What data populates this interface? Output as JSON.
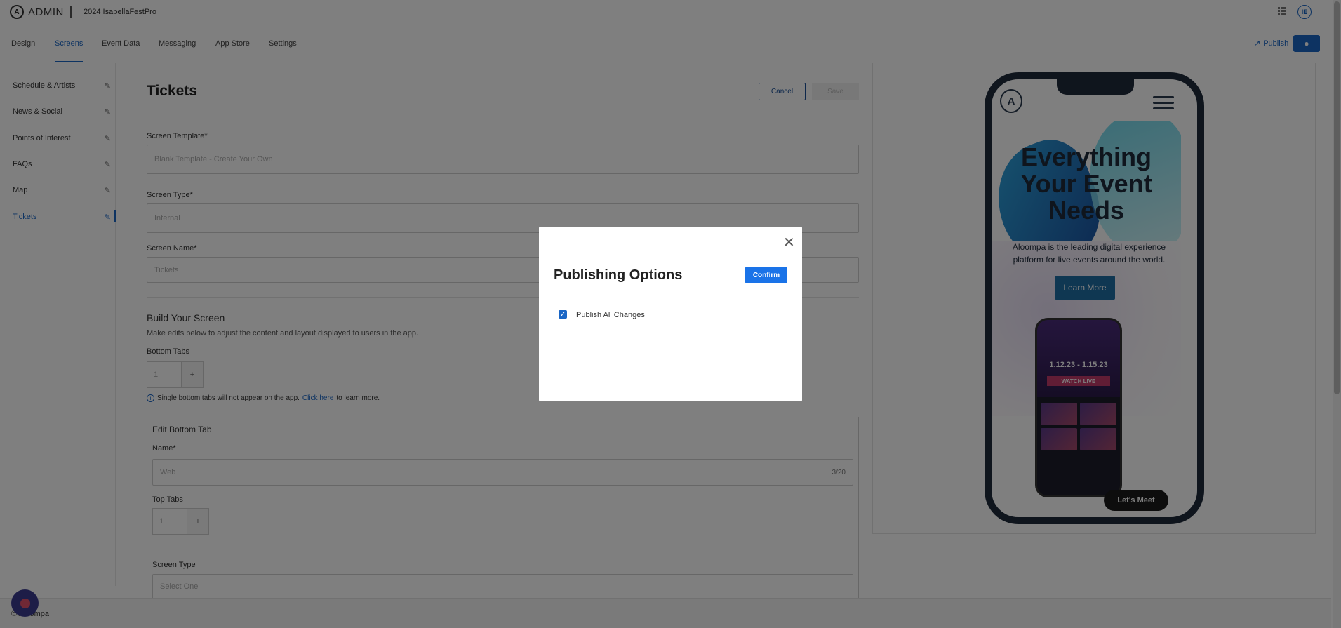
{
  "header": {
    "logo_text": "ADMIN",
    "logo_mark": "A",
    "project_name": "2024 IsabellaFestPro",
    "avatar_initials": "IE"
  },
  "nav": {
    "tabs": [
      {
        "label": "Design"
      },
      {
        "label": "Screens"
      },
      {
        "label": "Event Data"
      },
      {
        "label": "Messaging"
      },
      {
        "label": "App Store"
      },
      {
        "label": "Settings"
      }
    ],
    "active_tab": "Screens",
    "publish_label": "Publish",
    "apple_icon": "apple-icon"
  },
  "sidebar": {
    "items": [
      {
        "label": "Schedule & Artists"
      },
      {
        "label": "News & Social"
      },
      {
        "label": "Points of Interest"
      },
      {
        "label": "FAQs"
      },
      {
        "label": "Map"
      },
      {
        "label": "Tickets"
      }
    ],
    "active_item": "Tickets"
  },
  "main": {
    "title": "Tickets",
    "cancel_label": "Cancel",
    "save_label": "Save",
    "screen_template_label": "Screen Template*",
    "screen_template_value": "Blank Template - Create Your Own",
    "screen_type_label": "Screen Type*",
    "screen_type_value": "Internal",
    "screen_name_label": "Screen Name*",
    "screen_name_value": "Tickets",
    "build_title": "Build Your Screen",
    "build_desc": "Make edits below to adjust the content and layout displayed to users in the app.",
    "bottom_tabs_label": "Bottom Tabs",
    "bottom_tabs_value": "1",
    "plus": "+",
    "info_text": "Single bottom tabs will not appear on the app.",
    "info_link": "Click here",
    "info_suffix": "to learn more.",
    "edit_bottom_tab_title": "Edit Bottom Tab",
    "name_label": "Name*",
    "name_value": "Web",
    "name_counter": "3/20",
    "top_tabs_label": "Top Tabs",
    "top_tabs_value": "1",
    "screen_type2_label": "Screen Type",
    "screen_type2_value": "Select One"
  },
  "preview": {
    "heading": "Everything Your Event Needs",
    "subtext": "Aloompa is the leading digital experience platform for live events around the world.",
    "learn_more": "Learn More",
    "mini_dates": "1.12.23 - 1.15.23",
    "mini_live": "WATCH LIVE",
    "lets_meet": "Let's Meet"
  },
  "footer": {
    "text": "© Aloompa"
  },
  "modal": {
    "title": "Publishing Options",
    "confirm_label": "Confirm",
    "checkbox_label": "Publish All Changes",
    "checkbox_checked": true,
    "close_glyph": "✕",
    "check_glyph": "✓"
  },
  "colors": {
    "accent": "#1a66c5",
    "confirm": "#1a73e8",
    "overlay": "rgba(0,0,0,0.5)"
  }
}
